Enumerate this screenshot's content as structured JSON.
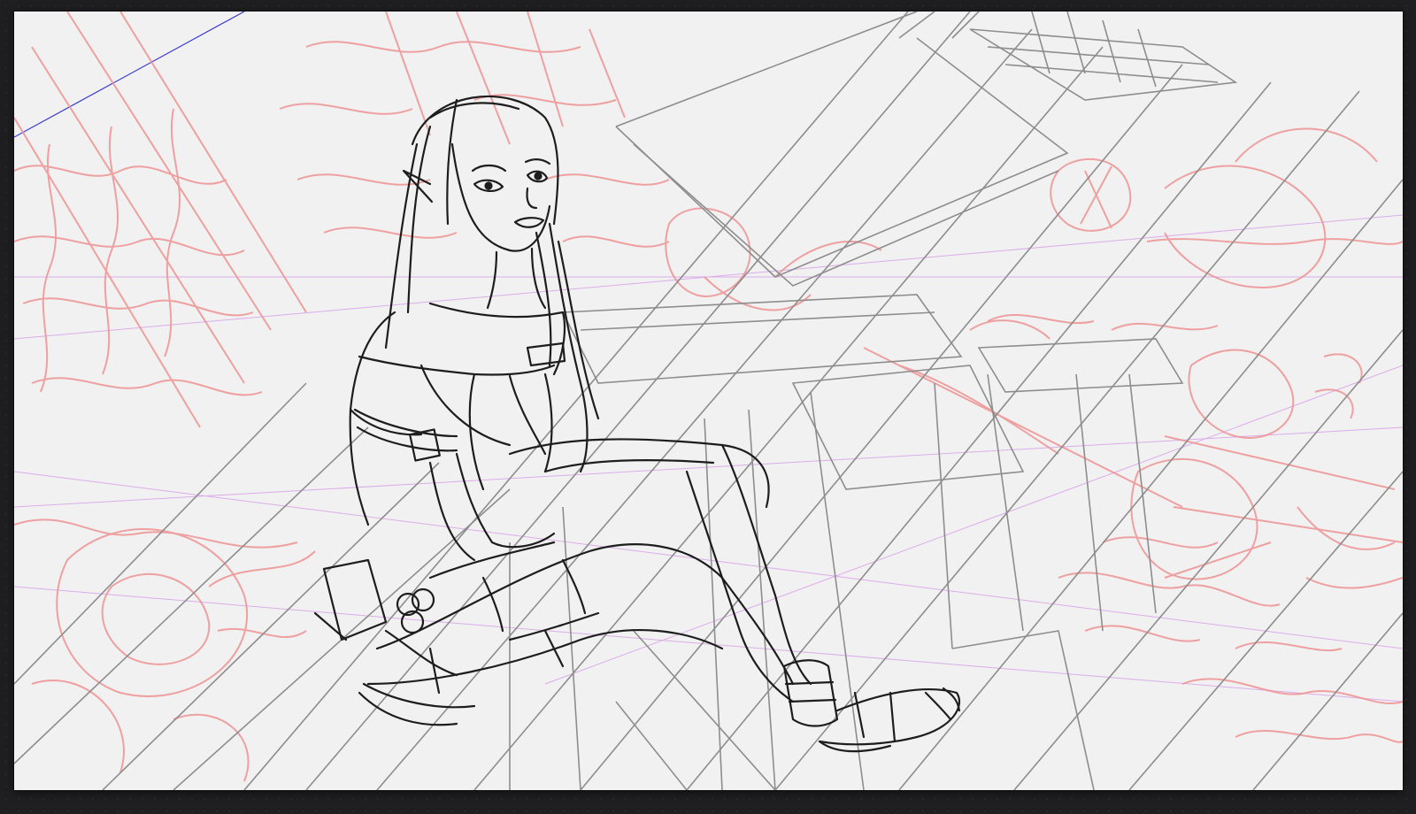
{
  "app": {
    "view": "drawing-canvas"
  },
  "canvas": {
    "layers": [
      {
        "name": "perspective-guides",
        "color": "#c889e0"
      },
      {
        "name": "horizon-guide",
        "color": "#3a3ad0"
      },
      {
        "name": "background-sketch",
        "color": "#ee8f8f"
      },
      {
        "name": "architecture-lines",
        "color": "#8a8a8a"
      },
      {
        "name": "figure-lineart",
        "color": "#1b1b1b"
      }
    ],
    "paper_color": "#f1f1f1",
    "workspace_color": "#1f1f21"
  }
}
